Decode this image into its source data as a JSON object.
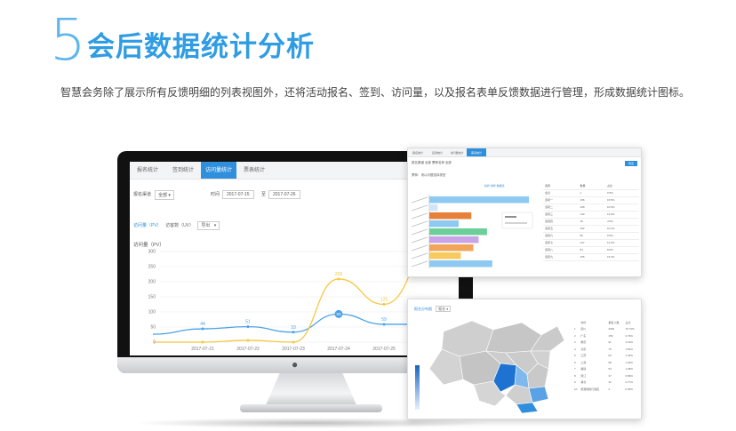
{
  "header": {
    "number": "5",
    "title": "会后数据统计分析",
    "description": "智慧会务除了展示所有反馈明细的列表视图外，还将活动报名、签到、访问量，以及报名表单反馈数据进行管理，形成数据统计图标。"
  },
  "screen": {
    "tabs": [
      {
        "label": "报名统计",
        "active": false
      },
      {
        "label": "签到统计",
        "active": false
      },
      {
        "label": "访问量统计",
        "active": true
      },
      {
        "label": "票表统计",
        "active": false
      }
    ],
    "filters": {
      "channel_label": "报名渠道",
      "channel_value": "全部",
      "time_label": "时间",
      "date_start": "2017-07-15",
      "date_end": "2017-07-26",
      "date_sep": "至"
    },
    "metrics": {
      "pv": "访问量（PV）",
      "uv": "访客数（UV）",
      "export": "导出"
    },
    "chart_title": "访问量（PV）"
  },
  "chart_data": {
    "type": "line",
    "title": "访问量（PV）",
    "categories": [
      "2017-07-21",
      "2017-07-22",
      "2017-07-23",
      "2017-07-24",
      "2017-07-25"
    ],
    "y_ticks": [
      0,
      50,
      100,
      150,
      200,
      250,
      300
    ],
    "ylim": [
      0,
      300
    ],
    "series": [
      {
        "values": [
          44,
          51,
          33,
          93,
          59
        ],
        "color": "#4aa3e8"
      },
      {
        "values": [
          0,
          6,
          0,
          209,
          125
        ],
        "color": "#f5c842"
      }
    ],
    "labels": [
      {
        "x": "2017-07-21",
        "text": "44"
      },
      {
        "x": "2017-07-22",
        "text": "51"
      },
      {
        "x": "2017-07-23",
        "text": "33"
      },
      {
        "x": "2017-07-24",
        "text": "209"
      },
      {
        "x": "2017-07-24",
        "text": "93"
      },
      {
        "x": "2017-07-25",
        "text": "125"
      },
      {
        "x": "2017-07-25",
        "text": "59"
      }
    ]
  },
  "panel1": {
    "tabs": [
      {
        "label": "报名统计",
        "active": false
      },
      {
        "label": "签到统计",
        "active": false
      },
      {
        "label": "访问量统计",
        "active": false
      },
      {
        "label": "票表统计",
        "active": true
      }
    ],
    "filter_text": "报名渠道  全部    票种名称  全部",
    "button": "导出",
    "subtitle": "票种：请以问题选择类型",
    "chart_hdr": "柱状  饼状  数据表",
    "bars": [
      {
        "value": 95,
        "color": "#8ec9f2"
      },
      {
        "value": 8,
        "color": "#cfe6f8"
      },
      {
        "value": 40,
        "color": "#e7813a"
      },
      {
        "value": 28,
        "color": "#8ec9f2"
      },
      {
        "value": 55,
        "color": "#6ccf9a"
      },
      {
        "value": 47,
        "color": "#c8a4e6"
      },
      {
        "value": 42,
        "color": "#f0a55a"
      },
      {
        "value": 30,
        "color": "#f7c95e"
      },
      {
        "value": 60,
        "color": "#8ec9f2"
      }
    ],
    "table_headers": [
      "选项",
      "数量",
      "占比"
    ],
    "table_rows": [
      [
        "会议",
        "1",
        "0.5%"
      ],
      [
        "选项一",
        "156",
        "15.5%"
      ],
      [
        "选项二",
        "108",
        "10.5%"
      ],
      [
        "选项三",
        "130",
        "12.9%"
      ],
      [
        "选项四",
        "45",
        "4.5%"
      ],
      [
        "选项五",
        "102",
        "10.1%"
      ],
      [
        "选项六",
        "96",
        "9.5%"
      ],
      [
        "选项七",
        "127",
        "12.6%"
      ],
      [
        "选项八",
        "81",
        "8.0%"
      ],
      [
        "选项九",
        "155",
        "15.3%"
      ]
    ]
  },
  "panel2": {
    "title": "报名分布图",
    "select": "报名",
    "table_headers": [
      "",
      "省份",
      "报名人数",
      "占比"
    ],
    "table_rows": [
      [
        "1",
        "四川",
        "2936",
        "70.73%"
      ],
      [
        "2",
        "广东",
        "156",
        "3.76%"
      ],
      [
        "3",
        "重庆",
        "91",
        "2.19%"
      ],
      [
        "4",
        "北京",
        "75",
        "1.81%"
      ],
      [
        "5",
        "江苏",
        "60",
        "1.45%"
      ],
      [
        "6",
        "上海",
        "58",
        "1.40%"
      ],
      [
        "7",
        "福建",
        "53",
        "1.28%"
      ],
      [
        "8",
        "浙江",
        "37",
        "0.89%"
      ],
      [
        "9",
        "湖北",
        "32",
        "0.77%"
      ],
      [
        "10",
        "香港特别行政区",
        "2",
        "0.05%"
      ]
    ]
  }
}
